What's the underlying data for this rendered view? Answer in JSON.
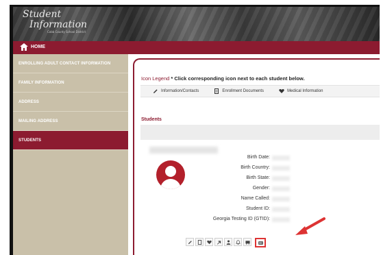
{
  "banner": {
    "logo_line1": "Student",
    "logo_line2": "Information",
    "logo_line3": "Cobb County School District"
  },
  "topnav": {
    "home_label": "HOME"
  },
  "sidebar": {
    "items": [
      {
        "label": "ENROLLING ADULT CONTACT INFORMATION",
        "active": false
      },
      {
        "label": "FAMILY INFORMATION",
        "active": false
      },
      {
        "label": "ADDRESS",
        "active": false
      },
      {
        "label": "MAILING ADDRESS",
        "active": false
      },
      {
        "label": "STUDENTS",
        "active": true
      }
    ]
  },
  "legend": {
    "title_prefix": "Icon Legend",
    "title_rest": "* Click corresponding icon next to each student below.",
    "items": [
      {
        "icon": "pencil-icon",
        "label": "Information/Contacts"
      },
      {
        "icon": "document-icon",
        "label": "Enrollment Documents"
      },
      {
        "icon": "heart-icon",
        "label": "Medical Information"
      }
    ]
  },
  "students": {
    "section_label": "Students",
    "fields": [
      "Birth Date:",
      "Birth Country:",
      "Birth State:",
      "Gender:",
      "Name Called:",
      "Student ID:",
      "Georgia Testing ID (GTID):"
    ],
    "toolbar_icons": [
      "pencil-icon",
      "document-icon",
      "heart-icon",
      "share-arrow-icon",
      "person-icon",
      "bell-icon",
      "bus-icon",
      "id-card-icon"
    ]
  },
  "colors": {
    "brand": "#8c1b30",
    "avatar": "#b3202b",
    "annotation": "#dd3333"
  }
}
